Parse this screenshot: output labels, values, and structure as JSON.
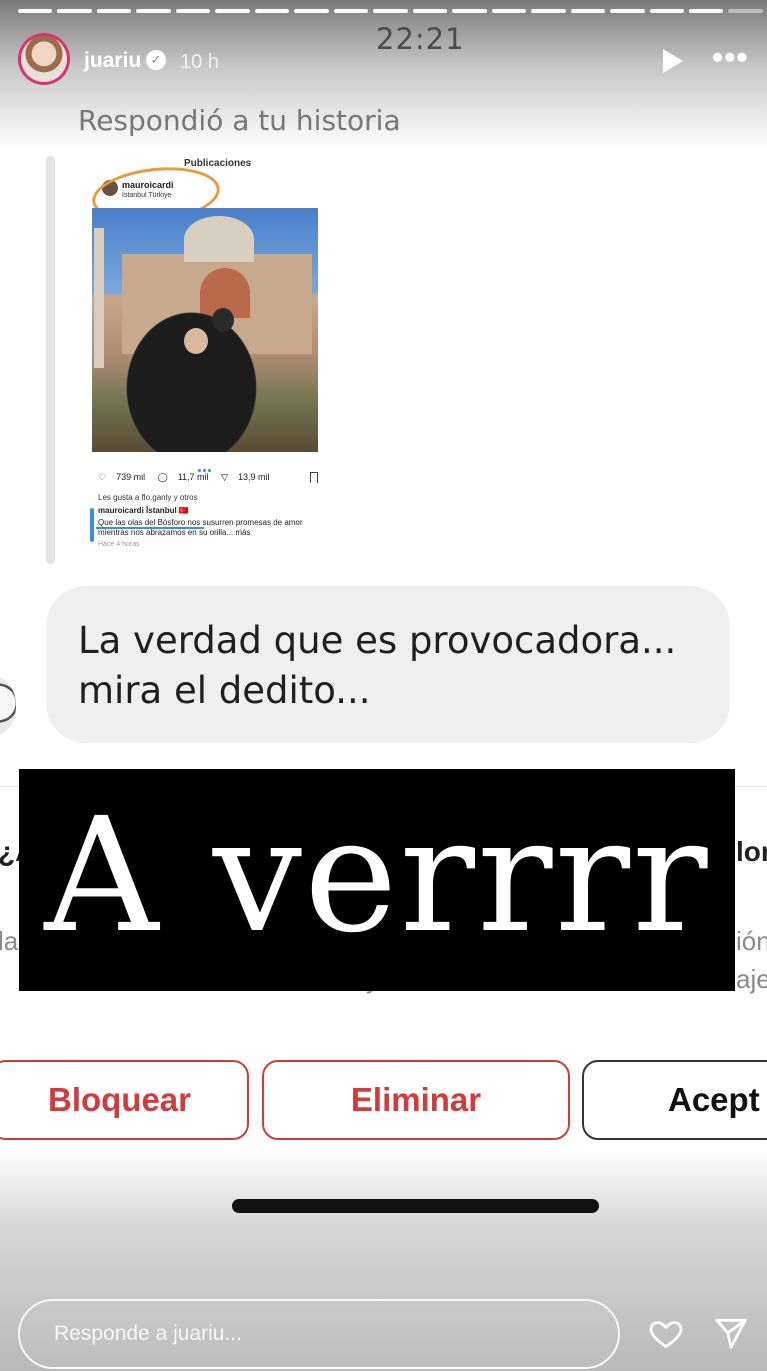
{
  "status": {
    "time": "22:21"
  },
  "story": {
    "username": "juariu",
    "time_ago": "10 h",
    "reply_label": "Respondió a tu historia",
    "progress_segments": 19,
    "progress_filled": 18
  },
  "thumbnail": {
    "title": "Publicaciones",
    "user": "mauroicardi",
    "location": "İstanbul Türkiye",
    "likes": "739 mil",
    "comments": "11,7 mil",
    "shares": "13,9 mil",
    "liked_by": "Les gusta a flo.ganly y otros",
    "caption_user": "mauroicardi İstanbul 🇹🇷",
    "caption": "Que las olas del Bósforo nos susurren promesas de amor mientras nos abrazamos en su orilla... más",
    "time": "Hace 4 horas"
  },
  "message": {
    "text": "La verdad que es provocadora... mira el dedito..."
  },
  "request_partial": {
    "title_left": "¿A",
    "title_right": "lor",
    "body_left": "la",
    "body_right_1": "ión",
    "body_right_2": "aje",
    "body_mid": "y"
  },
  "overlay": {
    "text": "A verrrr"
  },
  "buttons": {
    "block": "Bloquear",
    "delete": "Eliminar",
    "accept": "Acept"
  },
  "reply": {
    "placeholder": "Responde a juariu..."
  },
  "colors": {
    "danger": "#d33a3a",
    "bubble": "#efefef"
  }
}
